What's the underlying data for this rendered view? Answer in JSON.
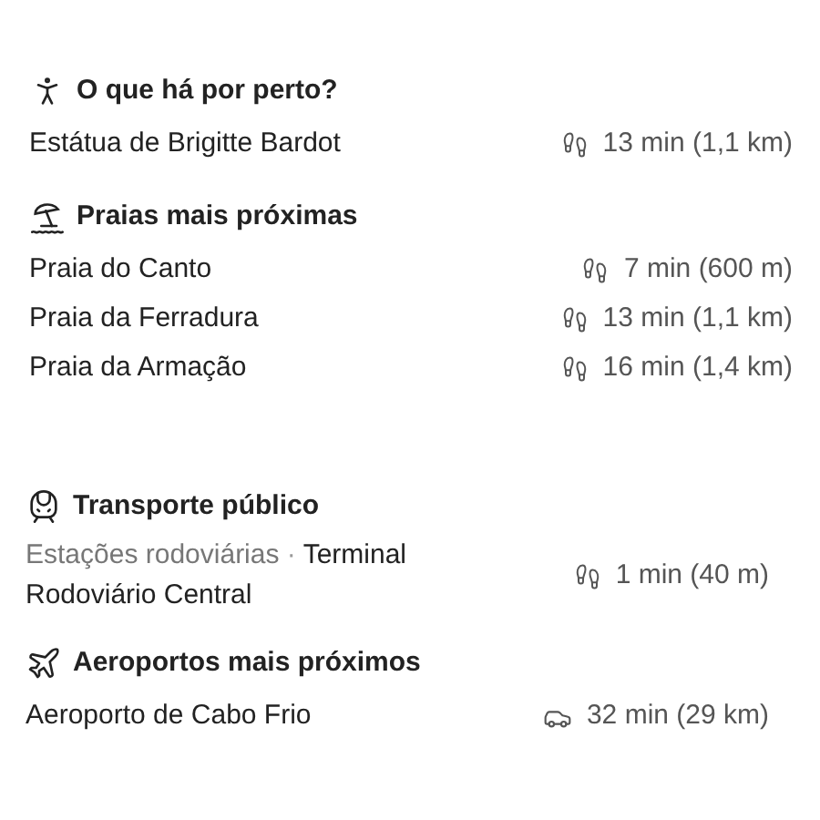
{
  "groups": [
    {
      "sections": [
        {
          "kind": "walker",
          "title": "O que há por perto?",
          "items": [
            {
              "name": "Estátua de Brigitte Bardot",
              "kind": "walk",
              "time": "13 min (1,1 km)"
            }
          ]
        },
        {
          "kind": "beach",
          "title": "Praias mais próximas",
          "items": [
            {
              "name": "Praia do Canto",
              "kind": "walk",
              "time": "7 min (600 m)"
            },
            {
              "name": "Praia da Ferradura",
              "kind": "walk",
              "time": "13 min (1,1 km)"
            },
            {
              "name": "Praia da Armação",
              "kind": "walk",
              "time": "16 min (1,4 km)"
            }
          ]
        }
      ]
    },
    {
      "sections": [
        {
          "kind": "train",
          "title": "Transporte público",
          "items": [
            {
              "category": "Estações rodoviárias",
              "separator": "·",
              "name": "Terminal Rodoviário Central",
              "kind": "walk",
              "time": "1 min (40 m)"
            }
          ]
        },
        {
          "kind": "plane",
          "title": "Aeroportos mais próximos",
          "items": [
            {
              "name": "Aeroporto de Cabo Frio",
              "kind": "car",
              "time": "32 min (29 km)"
            }
          ]
        }
      ]
    }
  ]
}
